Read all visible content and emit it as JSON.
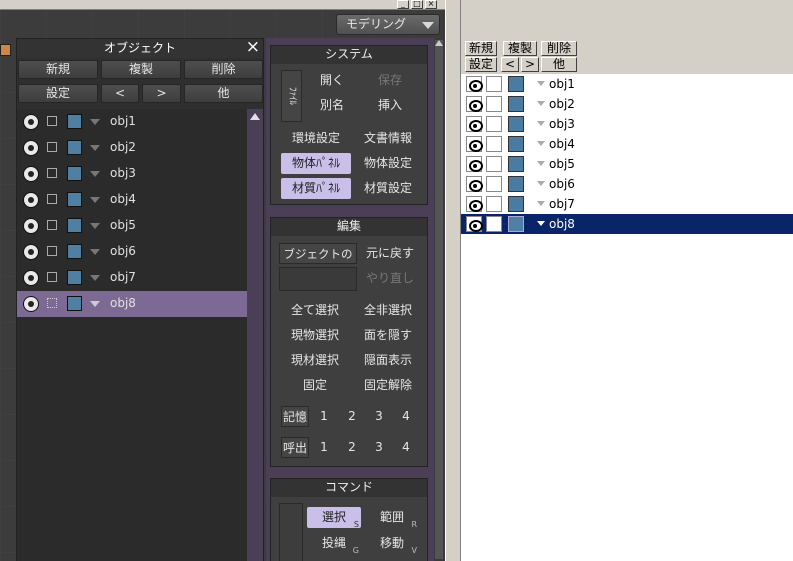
{
  "mode": {
    "label": "モデリング"
  },
  "object_panel": {
    "title": "オブジェクト",
    "close": "×",
    "row1": [
      "新規",
      "複製",
      "削除"
    ],
    "row2": [
      "設定",
      "<",
      ">",
      "他"
    ],
    "objects": [
      "obj1",
      "obj2",
      "obj3",
      "obj4",
      "obj5",
      "obj6",
      "obj7",
      "obj8"
    ],
    "selected": "obj8",
    "swatch_color": "#4f7fa2"
  },
  "system": {
    "title": "システム",
    "file_tag": "ﾌｧｲﾙ",
    "open": "開く",
    "save": "保存",
    "save_as": "別名",
    "insert": "挿入",
    "env": "環境設定",
    "doc_info": "文書情報",
    "obj_panel": "物体ﾊﾟﾈﾙ",
    "obj_settings": "物体設定",
    "mat_panel": "材質ﾊﾟﾈﾙ",
    "mat_settings": "材質設定"
  },
  "edit": {
    "title": "編集",
    "undo_name": "ブジェクトの作",
    "undo": "元に戻す",
    "redo": "やり直し",
    "select_all": "全て選択",
    "deselect_all": "全非選択",
    "sel_object": "現物選択",
    "hide_face": "面を隠す",
    "sel_material": "現材選択",
    "show_hidden": "隠面表示",
    "fix": "固定",
    "unfix": "固定解除",
    "memory": "記憶",
    "recall": "呼出",
    "slots": [
      "1",
      "2",
      "3",
      "4"
    ]
  },
  "command": {
    "title": "コマンド",
    "select": "選択",
    "select_key": "S",
    "range": "範囲",
    "range_key": "R",
    "lasso": "投縄",
    "lasso_key": "G",
    "move": "移動",
    "move_key": "V"
  },
  "right_panel": {
    "row1": [
      "新規",
      "複製",
      "削除"
    ],
    "row2": [
      "設定",
      "<",
      ">",
      "他"
    ],
    "objects": [
      "obj1",
      "obj2",
      "obj3",
      "obj4",
      "obj5",
      "obj6",
      "obj7",
      "obj8"
    ],
    "selected": "obj8",
    "selection_color": "#0a246a"
  },
  "window_controls": {
    "minimize": "_",
    "maximize": "□",
    "close": "×"
  }
}
